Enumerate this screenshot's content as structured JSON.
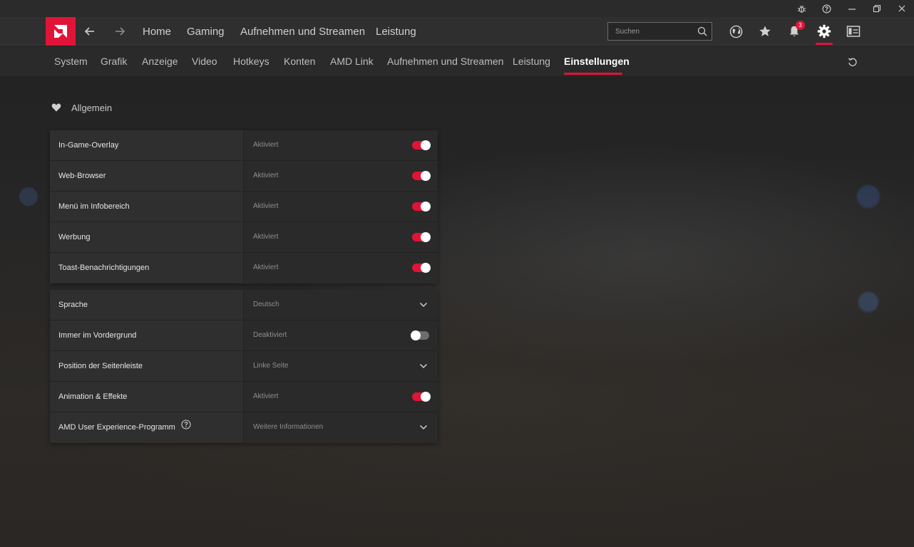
{
  "titlebar": {
    "icons": [
      "bug-icon",
      "help-icon",
      "minimize-icon",
      "restore-icon",
      "close-icon"
    ]
  },
  "topnav": {
    "logo": "amd-logo",
    "links": [
      "Home",
      "Gaming",
      "Aufnehmen und Streamen",
      "Leistung"
    ],
    "search_placeholder": "Suchen",
    "notification_count": "3",
    "icons": [
      "globe-icon",
      "star-icon",
      "bell-icon",
      "gear-icon",
      "sidebar-layout-icon"
    ]
  },
  "subnav": {
    "tabs": [
      "System",
      "Grafik",
      "Anzeige",
      "Video",
      "Hotkeys",
      "Konten",
      "AMD Link",
      "Aufnehmen und Streamen",
      "Leistung",
      "Einstellungen"
    ],
    "active": "Einstellungen"
  },
  "section": {
    "title": "Allgemein"
  },
  "panel1": [
    {
      "name": "In-Game-Overlay",
      "value": "Aktiviert",
      "control": "toggle",
      "on": true
    },
    {
      "name": "Web-Browser",
      "value": "Aktiviert",
      "control": "toggle",
      "on": true
    },
    {
      "name": "Menü im Infobereich",
      "value": "Aktiviert",
      "control": "toggle",
      "on": true
    },
    {
      "name": "Werbung",
      "value": "Aktiviert",
      "control": "toggle",
      "on": true
    },
    {
      "name": "Toast-Benachrichtigungen",
      "value": "Aktiviert",
      "control": "toggle",
      "on": true
    }
  ],
  "panel2": [
    {
      "name": "Sprache",
      "value": "Deutsch",
      "control": "dropdown"
    },
    {
      "name": "Immer im Vordergrund",
      "value": "Deaktiviert",
      "control": "toggle",
      "on": false
    },
    {
      "name": "Position der Seitenleiste",
      "value": "Linke Seite",
      "control": "dropdown"
    },
    {
      "name": "Animation & Effekte",
      "value": "Aktiviert",
      "control": "toggle",
      "on": true
    },
    {
      "name": "AMD User Experience-Programm",
      "value": "Weitere Informationen",
      "control": "dropdown",
      "help": true
    }
  ],
  "colors": {
    "accent": "#e01437",
    "toggle_off": "#6d6d6d"
  }
}
